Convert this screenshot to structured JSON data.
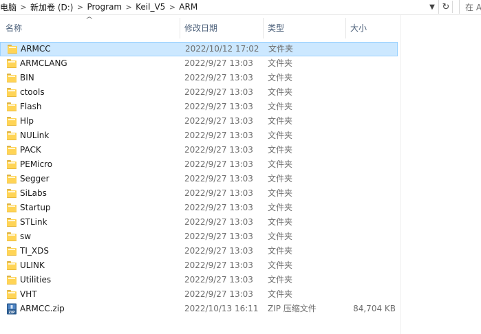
{
  "address_bar": {
    "crumbs": [
      "电脑",
      "新加卷 (D:)",
      "Program",
      "Keil_V5",
      "ARM"
    ],
    "search_placeholder": "在 ARM"
  },
  "columns": {
    "name": "名称",
    "date": "修改日期",
    "type": "类型",
    "size": "大小"
  },
  "files": [
    {
      "name": "ARMCC",
      "date": "2022/10/12 17:02",
      "type": "文件夹",
      "size": "",
      "icon": "folder-icon",
      "selected": true
    },
    {
      "name": "ARMCLANG",
      "date": "2022/9/27 13:03",
      "type": "文件夹",
      "size": "",
      "icon": "folder-icon"
    },
    {
      "name": "BIN",
      "date": "2022/9/27 13:03",
      "type": "文件夹",
      "size": "",
      "icon": "folder-icon"
    },
    {
      "name": "ctools",
      "date": "2022/9/27 13:03",
      "type": "文件夹",
      "size": "",
      "icon": "folder-icon"
    },
    {
      "name": "Flash",
      "date": "2022/9/27 13:03",
      "type": "文件夹",
      "size": "",
      "icon": "folder-icon"
    },
    {
      "name": "Hlp",
      "date": "2022/9/27 13:03",
      "type": "文件夹",
      "size": "",
      "icon": "folder-icon"
    },
    {
      "name": "NULink",
      "date": "2022/9/27 13:03",
      "type": "文件夹",
      "size": "",
      "icon": "folder-icon"
    },
    {
      "name": "PACK",
      "date": "2022/9/27 13:03",
      "type": "文件夹",
      "size": "",
      "icon": "folder-icon"
    },
    {
      "name": "PEMicro",
      "date": "2022/9/27 13:03",
      "type": "文件夹",
      "size": "",
      "icon": "folder-icon"
    },
    {
      "name": "Segger",
      "date": "2022/9/27 13:03",
      "type": "文件夹",
      "size": "",
      "icon": "folder-icon"
    },
    {
      "name": "SiLabs",
      "date": "2022/9/27 13:03",
      "type": "文件夹",
      "size": "",
      "icon": "folder-icon"
    },
    {
      "name": "Startup",
      "date": "2022/9/27 13:03",
      "type": "文件夹",
      "size": "",
      "icon": "folder-icon"
    },
    {
      "name": "STLink",
      "date": "2022/9/27 13:03",
      "type": "文件夹",
      "size": "",
      "icon": "folder-icon"
    },
    {
      "name": "sw",
      "date": "2022/9/27 13:03",
      "type": "文件夹",
      "size": "",
      "icon": "folder-icon"
    },
    {
      "name": "TI_XDS",
      "date": "2022/9/27 13:03",
      "type": "文件夹",
      "size": "",
      "icon": "folder-icon"
    },
    {
      "name": "ULINK",
      "date": "2022/9/27 13:03",
      "type": "文件夹",
      "size": "",
      "icon": "folder-icon"
    },
    {
      "name": "Utilities",
      "date": "2022/9/27 13:03",
      "type": "文件夹",
      "size": "",
      "icon": "folder-icon"
    },
    {
      "name": "VHT",
      "date": "2022/9/27 13:03",
      "type": "文件夹",
      "size": "",
      "icon": "folder-icon"
    },
    {
      "name": "ARMCC.zip",
      "date": "2022/10/13 16:11",
      "type": "ZIP 压缩文件",
      "size": "84,704 KB",
      "icon": "zip-icon"
    }
  ],
  "colors": {
    "selection_bg": "#cce8ff",
    "selection_border": "#99d1ff",
    "header_text": "#4c607a",
    "folder_yellow": "#ffd456"
  }
}
